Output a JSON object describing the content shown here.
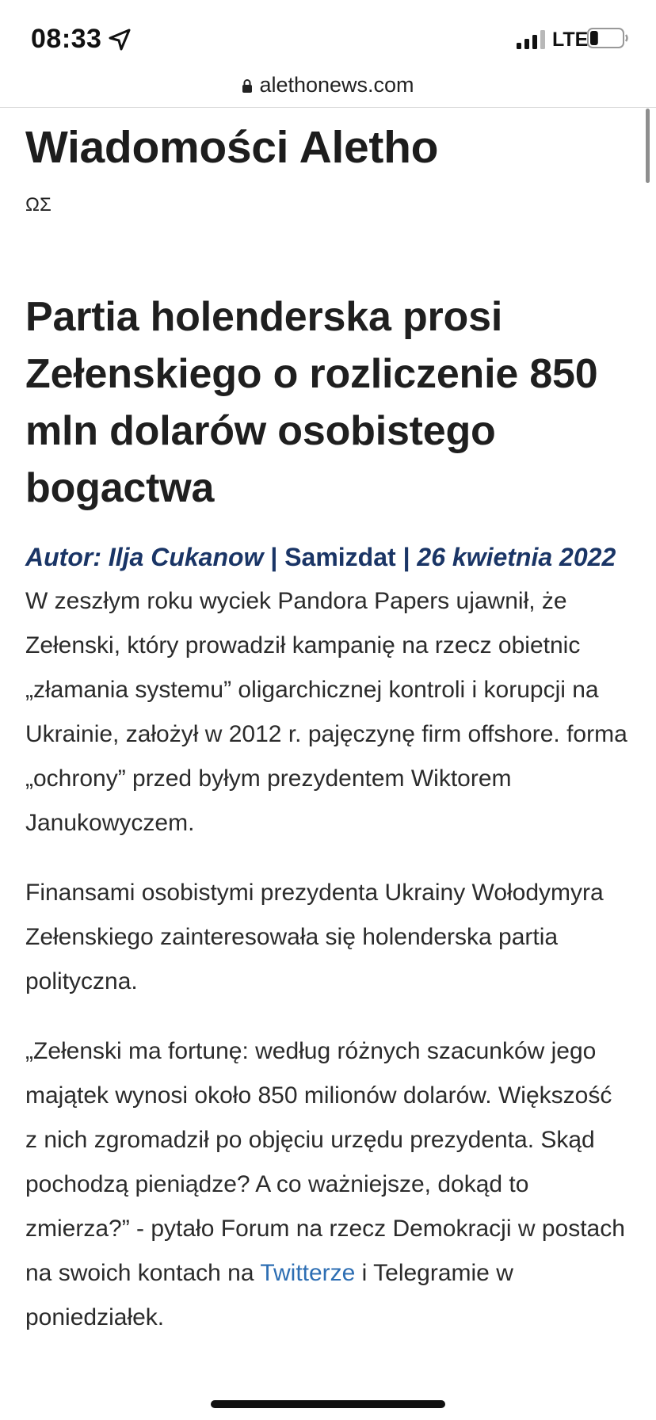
{
  "status_bar": {
    "time": "08:33",
    "network": "LTE",
    "battery_level": 0.25
  },
  "browser": {
    "url": "alethonews.com"
  },
  "site": {
    "title": "Wiadomości Aletho",
    "tagline": "ΩΣ"
  },
  "article": {
    "headline": "Partia holenderska prosi Zełenskiego o rozliczenie 850 mln dolarów osobistego bogactwa",
    "byline": {
      "author": "Autor: Ilja Cukanow",
      "sep1": " | ",
      "source": "Samizdat",
      "sep2": " | ",
      "date": "26 kwietnia 2022"
    },
    "paragraphs": [
      "W zeszłym roku wyciek Pandora Papers ujawnił, że Zełenski, który prowadził kampanię na rzecz obietnic „złamania systemu” oligarchicznej kontroli i korupcji na Ukrainie, założył w 2012 r. pajęczynę firm offshore. forma „ochrony” przed byłym prezydentem Wiktorem Janukowyczem.",
      "Finansami osobistymi prezydenta Ukrainy Wołodymyra Zełenskiego zainteresowała się holenderska partia polityczna."
    ],
    "quote_paragraph": {
      "text_before_link": "„Zełenski ma fortunę: według różnych szacunków jego majątek wynosi około 850 milionów dolarów. Większość z nich zgromadził po objęciu urzędu prezydenta. Skąd pochodzą pieniądze? A co ważniejsze, dokąd to zmierza?” - pytało Forum na rzecz Demokracji w postach na swoich  kontach na ",
      "link_text": "Twitterze",
      "text_after_link": "  i Telegramie w poniedziałek."
    }
  }
}
